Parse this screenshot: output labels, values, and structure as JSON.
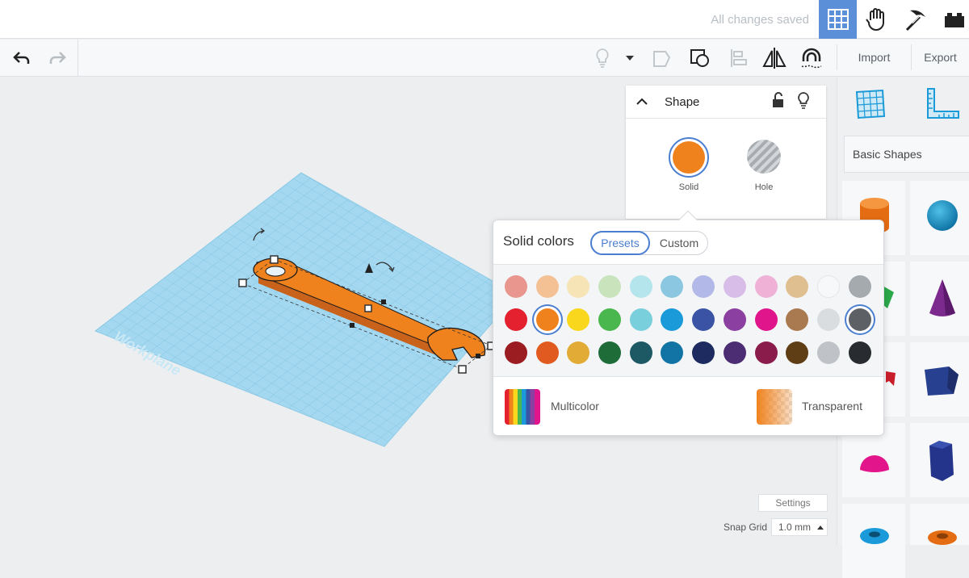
{
  "status": {
    "saved_text": "All changes saved"
  },
  "header": {
    "import_label": "Import",
    "export_label": "Export"
  },
  "icons": {
    "grid_view": "grid-view-icon",
    "tinker_hand": "hand-icon",
    "build_pickaxe": "pickaxe-icon",
    "bricks": "brick-icon",
    "undo": "undo-icon",
    "redo": "redo-icon"
  },
  "shape_panel": {
    "title": "Shape",
    "solid_label": "Solid",
    "hole_label": "Hole",
    "solid_color": "#f0821e"
  },
  "color_popup": {
    "title": "Solid colors",
    "tabs": [
      {
        "label": "Presets",
        "active": true
      },
      {
        "label": "Custom",
        "active": false
      }
    ],
    "rows": [
      [
        "#e8968e",
        "#f4c195",
        "#f6e3b6",
        "#c9e3bd",
        "#b5e5ec",
        "#8cc7e2",
        "#b2b8e8",
        "#d8bde8",
        "#f0b1d6",
        "#dfbf8f",
        "#f7f8f9",
        "#a5aaaf"
      ],
      [
        "#e3212f",
        "#f0821e",
        "#f8d71c",
        "#4ab64e",
        "#79cfdc",
        "#1a9ad8",
        "#3a53a4",
        "#8b3fa1",
        "#e0158b",
        "#a97a50",
        "#dadde0",
        "#5d6166"
      ],
      [
        "#9b1c21",
        "#e15b20",
        "#e1ab35",
        "#1e6c38",
        "#1d5964",
        "#1273a5",
        "#1d2b60",
        "#4c2c73",
        "#8a1c4c",
        "#603e15",
        "#bfc3c8",
        "#282b2f"
      ]
    ],
    "selected": [
      [
        1,
        1
      ],
      [
        1,
        11
      ]
    ],
    "multicolor_label": "Multicolor",
    "transparent_label": "Transparent"
  },
  "library": {
    "category_label": "Basic Shapes"
  },
  "footer": {
    "settings_label": "Settings",
    "snap_label": "Snap Grid",
    "snap_value": "1.0 mm"
  },
  "workplane": {
    "label": "Workplane"
  }
}
